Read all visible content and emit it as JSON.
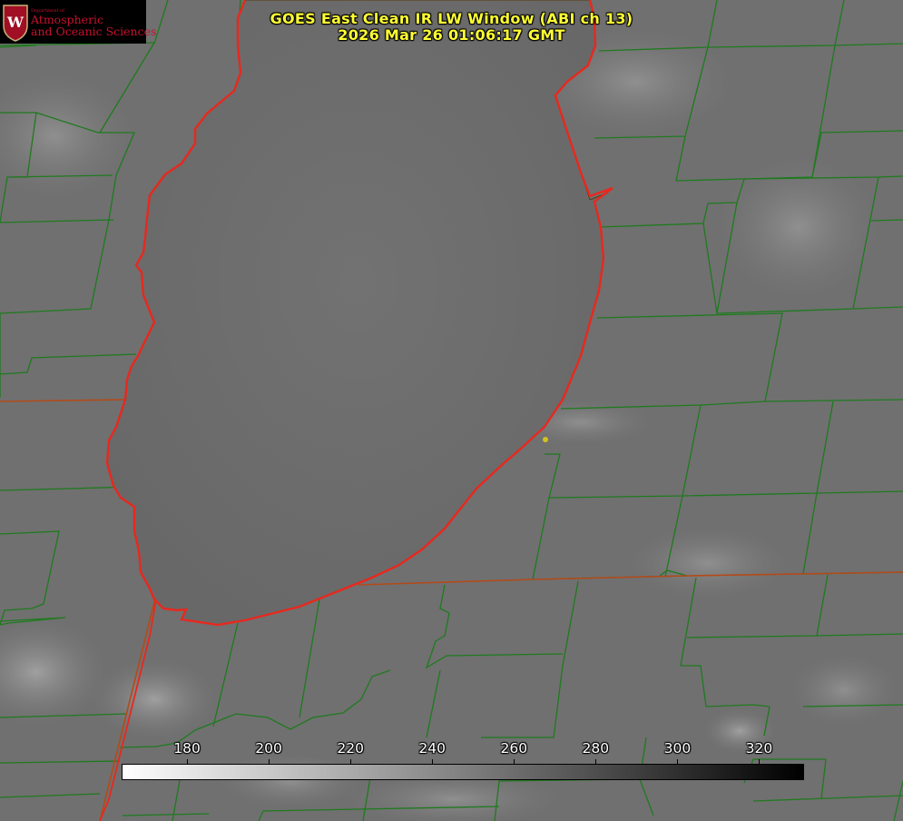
{
  "title": {
    "line1": "GOES East Clean IR LW Window (ABI ch 13)",
    "line2": "2026 Mar 26 01:06:17 GMT"
  },
  "logo": {
    "department": "Department of",
    "line1": "Atmospheric",
    "line2": "and Oceanic Sciences"
  },
  "colorbar": {
    "ticks": [
      "180",
      "200",
      "220",
      "240",
      "260",
      "280",
      "300",
      "320"
    ],
    "min": 164,
    "max": 331,
    "scale": "white-to-black (brightness temperature, K)"
  },
  "colors": {
    "lake_outline": "#e8281e",
    "county_lines": "#1f7a1f",
    "state_line": "#b34a1a",
    "title": "#ffff33",
    "point_marker": "#d4c21e"
  }
}
